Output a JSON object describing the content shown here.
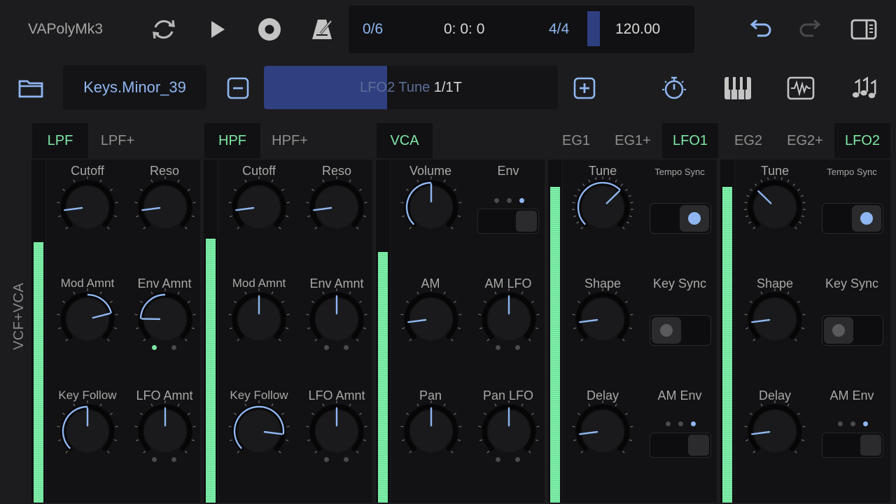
{
  "app": {
    "title": "VAPolyMk3"
  },
  "transport": {
    "position": "0/6",
    "time": "0: 0: 0",
    "signature": "4/4",
    "tempo": "120.00"
  },
  "preset": {
    "name": "Keys.Minor_39"
  },
  "param": {
    "name": "LFO2 Tune",
    "value": "1/1T",
    "fill": 0.42
  },
  "icons": {
    "top": [
      "loop-icon",
      "play-icon",
      "record-icon",
      "metronome-icon",
      "undo-icon",
      "redo-icon",
      "sidebar-icon"
    ],
    "second": [
      "folder-icon",
      "minus-icon",
      "plus-icon",
      "timer-icon",
      "keyboard-icon",
      "waveform-icon",
      "notes-icon"
    ]
  },
  "tabs": [
    {
      "label": "LPF",
      "active": true
    },
    {
      "label": "LPF+",
      "active": false
    },
    {
      "label": "HPF",
      "active": true
    },
    {
      "label": "HPF+",
      "active": false
    },
    {
      "label": "VCA",
      "active": true
    },
    {
      "label": "EG1",
      "active": false
    },
    {
      "label": "EG1+",
      "active": false
    },
    {
      "label": "LFO1",
      "active": true
    },
    {
      "label": "EG2",
      "active": false
    },
    {
      "label": "EG2+",
      "active": false
    },
    {
      "label": "LFO2",
      "active": true
    }
  ],
  "section_label": "VCF+VCA",
  "meters": [
    0.76,
    0.77,
    0.73,
    0.92,
    0.92
  ],
  "knobs": {
    "lpf_cutoff": "Cutoff",
    "lpf_reso": "Reso",
    "lpf_mod": "Mod Amnt",
    "lpf_env": "Env Amnt",
    "lpf_key": "Key Follow",
    "lpf_lfo": "LFO Amnt",
    "hpf_cutoff": "Cutoff",
    "hpf_reso": "Reso",
    "hpf_mod": "Mod Amnt",
    "hpf_env": "Env Amnt",
    "hpf_key": "Key Follow",
    "hpf_lfo": "LFO Amnt",
    "vca_volume": "Volume",
    "vca_env": "Env",
    "vca_am": "AM",
    "vca_amlfo": "AM LFO",
    "vca_pan": "Pan",
    "vca_panlfo": "Pan LFO",
    "lfo1_tune": "Tune",
    "lfo1_sync": "Tempo Sync",
    "lfo1_shape": "Shape",
    "lfo1_keysync": "Key Sync",
    "lfo1_delay": "Delay",
    "lfo1_amenv": "AM Env",
    "lfo2_tune": "Tune",
    "lfo2_sync": "Tempo Sync",
    "lfo2_shape": "Shape",
    "lfo2_keysync": "Key Sync",
    "lfo2_delay": "Delay",
    "lfo2_amenv": "AM Env"
  },
  "colors": {
    "accent_green": "#7fe7a6",
    "accent_blue": "#8fb6f0",
    "background": "#1c1c1e"
  }
}
